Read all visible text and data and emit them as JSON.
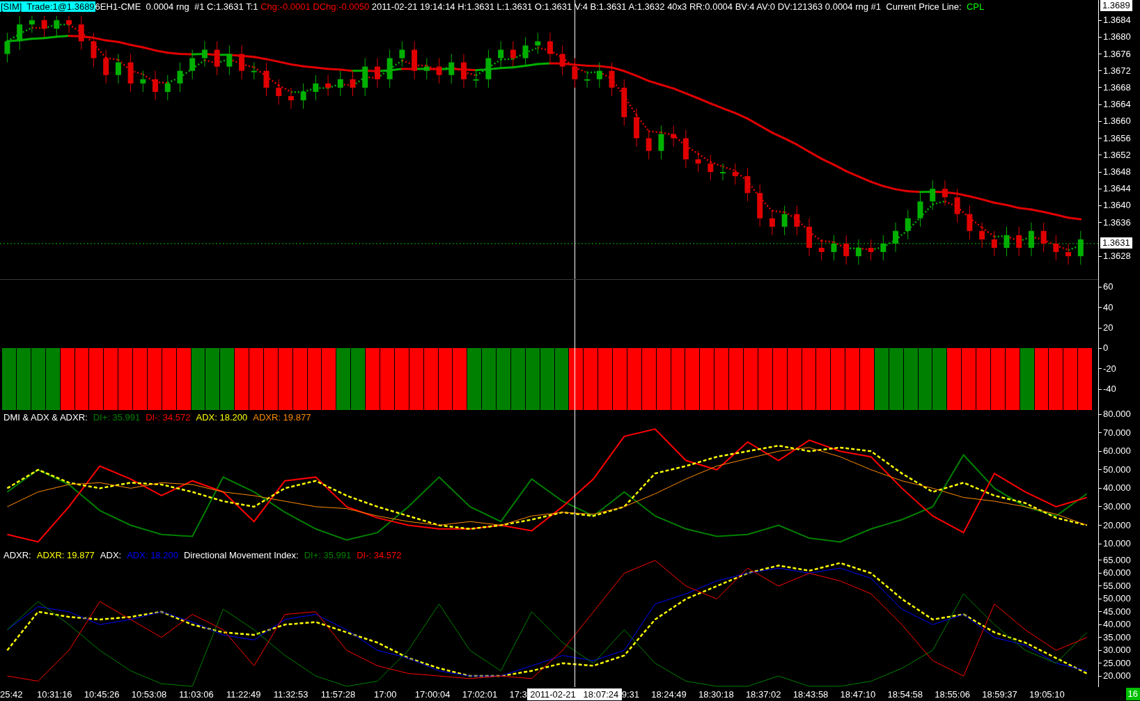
{
  "header": {
    "items": [
      {
        "kind": "badge",
        "text": "[SIM]  Trade:1@1.3689",
        "color": "#00ffff"
      },
      {
        "kind": "text",
        "text": "6EH1-CME  0.0004 rng  #1 C:1.3631 T:1 ",
        "color": "#ffffff"
      },
      {
        "kind": "text",
        "text": "Chg:-0.0001 DChg:-0.0050 ",
        "color": "#ff0000"
      },
      {
        "kind": "text",
        "text": "2011-02-21 19:14:14 H:1.3631 L:1.3631 O:1.3631 V:4 B:1.3631 A:1.3632 40x3 RR:0.0004 BV:4 AV:0 DV:121363 0.0004 rng #1  Current Price Line:  ",
        "color": "#ffffff"
      },
      {
        "kind": "text",
        "text": "CPL",
        "color": "#00ff00"
      }
    ],
    "last_price": "1.3689"
  },
  "price_pane": {
    "chart_data": {
      "type": "candlestick",
      "ylim": [
        1.36224,
        1.36855
      ],
      "yticks": [
        {
          "value": 1.3684,
          "label": "1.3684"
        },
        {
          "value": 1.368,
          "label": "1.3680"
        },
        {
          "value": 1.3676,
          "label": "1.3676"
        },
        {
          "value": 1.3672,
          "label": "1.3672"
        },
        {
          "value": 1.3668,
          "label": "1.3668"
        },
        {
          "value": 1.3664,
          "label": "1.3664"
        },
        {
          "value": 1.366,
          "label": "1.3660"
        },
        {
          "value": 1.3656,
          "label": "1.3656"
        },
        {
          "value": 1.3652,
          "label": "1.3652"
        },
        {
          "value": 1.3648,
          "label": "1.3648"
        },
        {
          "value": 1.3644,
          "label": "1.3644"
        },
        {
          "value": 1.364,
          "label": "1.3640"
        },
        {
          "value": 1.3636,
          "label": "1.3636"
        },
        {
          "value": 1.3628,
          "label": "1.3628"
        }
      ],
      "categories": [
        null,
        null,
        null,
        null,
        null,
        null,
        null,
        null,
        null,
        null,
        null,
        null,
        null,
        null,
        null,
        null,
        null,
        null,
        null,
        null,
        null,
        null,
        null,
        null,
        null,
        null,
        null,
        null,
        null,
        null,
        null,
        null,
        null,
        null,
        null,
        null,
        null,
        null,
        null,
        null,
        null,
        null,
        null,
        null,
        null,
        null,
        null,
        null,
        null,
        null,
        null,
        null,
        null,
        null,
        null,
        null,
        null,
        null,
        null,
        null,
        null,
        null,
        null,
        null,
        null,
        null,
        null,
        null,
        null,
        null,
        null,
        null,
        null,
        null,
        null,
        null,
        null,
        null,
        null,
        null,
        null,
        null,
        null,
        null,
        null,
        null,
        null,
        null
      ],
      "ohlc": [
        [
          1.3676,
          1.3681,
          1.3674,
          1.3679
        ],
        [
          1.3679,
          1.3685,
          1.3677,
          1.3683
        ],
        [
          1.3683,
          1.3685,
          1.3681,
          1.3684
        ],
        [
          1.3684,
          1.3685,
          1.368,
          1.3682
        ],
        [
          1.3682,
          1.3685,
          1.368,
          1.3684
        ],
        [
          1.3684,
          1.3685,
          1.3681,
          1.3683
        ],
        [
          1.3683,
          1.3685,
          1.3677,
          1.3679
        ],
        [
          1.3679,
          1.3681,
          1.3673,
          1.3675
        ],
        [
          1.3675,
          1.3677,
          1.3669,
          1.3671
        ],
        [
          1.3671,
          1.3676,
          1.3669,
          1.3674
        ],
        [
          1.3674,
          1.3676,
          1.3667,
          1.3669
        ],
        [
          1.3669,
          1.3672,
          1.3667,
          1.367
        ],
        [
          1.367,
          1.3672,
          1.3665,
          1.3667
        ],
        [
          1.3667,
          1.3671,
          1.3665,
          1.3669
        ],
        [
          1.3669,
          1.3674,
          1.3667,
          1.3672
        ],
        [
          1.3672,
          1.3677,
          1.367,
          1.3675
        ],
        [
          1.3675,
          1.3679,
          1.3673,
          1.3677
        ],
        [
          1.3677,
          1.3679,
          1.3671,
          1.3673
        ],
        [
          1.3673,
          1.3678,
          1.3671,
          1.3676
        ],
        [
          1.3676,
          1.3678,
          1.367,
          1.3672
        ],
        [
          1.3672,
          1.3674,
          1.367,
          1.3672
        ],
        [
          1.3672,
          1.3674,
          1.3666,
          1.3668
        ],
        [
          1.3668,
          1.367,
          1.3664,
          1.3666
        ],
        [
          1.3666,
          1.3668,
          1.3663,
          1.3665
        ],
        [
          1.3665,
          1.3669,
          1.3663,
          1.3667
        ],
        [
          1.3667,
          1.3671,
          1.3665,
          1.3669
        ],
        [
          1.3669,
          1.3671,
          1.3666,
          1.3668
        ],
        [
          1.3668,
          1.3672,
          1.3666,
          1.367
        ],
        [
          1.367,
          1.3672,
          1.3666,
          1.3668
        ],
        [
          1.3668,
          1.3675,
          1.3666,
          1.3673
        ],
        [
          1.3673,
          1.3675,
          1.3668,
          1.367
        ],
        [
          1.367,
          1.3677,
          1.3668,
          1.3675
        ],
        [
          1.3675,
          1.3679,
          1.3673,
          1.3677
        ],
        [
          1.3677,
          1.3679,
          1.367,
          1.3672
        ],
        [
          1.3672,
          1.3675,
          1.367,
          1.3673
        ],
        [
          1.3673,
          1.3675,
          1.3669,
          1.3671
        ],
        [
          1.3671,
          1.3676,
          1.3669,
          1.3674
        ],
        [
          1.3674,
          1.3676,
          1.3668,
          1.367
        ],
        [
          1.367,
          1.3672,
          1.3668,
          1.367
        ],
        [
          1.367,
          1.3677,
          1.3668,
          1.3675
        ],
        [
          1.3675,
          1.3679,
          1.3673,
          1.3677
        ],
        [
          1.3677,
          1.3679,
          1.3673,
          1.3675
        ],
        [
          1.3675,
          1.368,
          1.3673,
          1.3678
        ],
        [
          1.3678,
          1.3681,
          1.3676,
          1.3679
        ],
        [
          1.3679,
          1.3681,
          1.3674,
          1.3676
        ],
        [
          1.3676,
          1.3678,
          1.3671,
          1.3673
        ],
        [
          1.3673,
          1.3675,
          1.3668,
          1.367
        ],
        [
          1.367,
          1.3672,
          1.3668,
          1.367
        ],
        [
          1.367,
          1.3674,
          1.3668,
          1.3672
        ],
        [
          1.3672,
          1.3674,
          1.3666,
          1.3668
        ],
        [
          1.3668,
          1.367,
          1.3659,
          1.3661
        ],
        [
          1.3661,
          1.3663,
          1.3654,
          1.3656
        ],
        [
          1.3656,
          1.3658,
          1.3651,
          1.3653
        ],
        [
          1.3653,
          1.3659,
          1.3651,
          1.3657
        ],
        [
          1.3657,
          1.3659,
          1.3654,
          1.3656
        ],
        [
          1.3656,
          1.3658,
          1.3649,
          1.3651
        ],
        [
          1.3651,
          1.3653,
          1.3648,
          1.365
        ],
        [
          1.365,
          1.3652,
          1.3646,
          1.3648
        ],
        [
          1.3648,
          1.365,
          1.3646,
          1.3648
        ],
        [
          1.3648,
          1.365,
          1.3645,
          1.3647
        ],
        [
          1.3647,
          1.3649,
          1.3641,
          1.3643
        ],
        [
          1.3643,
          1.3645,
          1.3635,
          1.3637
        ],
        [
          1.3637,
          1.3639,
          1.3633,
          1.3635
        ],
        [
          1.3635,
          1.364,
          1.3633,
          1.3638
        ],
        [
          1.3638,
          1.364,
          1.3633,
          1.3635
        ],
        [
          1.3635,
          1.3637,
          1.3628,
          1.363
        ],
        [
          1.363,
          1.3632,
          1.3627,
          1.3629
        ],
        [
          1.3629,
          1.3633,
          1.3627,
          1.3631
        ],
        [
          1.3631,
          1.3633,
          1.3626,
          1.3628
        ],
        [
          1.3628,
          1.3632,
          1.3626,
          1.363
        ],
        [
          1.363,
          1.3632,
          1.3627,
          1.3629
        ],
        [
          1.3629,
          1.3633,
          1.3627,
          1.3631
        ],
        [
          1.3631,
          1.3636,
          1.3629,
          1.3634
        ],
        [
          1.3634,
          1.3639,
          1.3632,
          1.3637
        ],
        [
          1.3637,
          1.3643,
          1.3635,
          1.3641
        ],
        [
          1.3641,
          1.3646,
          1.3639,
          1.3644
        ],
        [
          1.3644,
          1.3646,
          1.364,
          1.3642
        ],
        [
          1.3642,
          1.3644,
          1.3636,
          1.3638
        ],
        [
          1.3638,
          1.364,
          1.3632,
          1.3634
        ],
        [
          1.3634,
          1.3636,
          1.363,
          1.3632
        ],
        [
          1.3632,
          1.3634,
          1.3628,
          1.363
        ],
        [
          1.363,
          1.3635,
          1.3628,
          1.3633
        ],
        [
          1.3633,
          1.3635,
          1.3628,
          1.363
        ],
        [
          1.363,
          1.3636,
          1.3628,
          1.3634
        ],
        [
          1.3634,
          1.3636,
          1.3629,
          1.3631
        ],
        [
          1.3631,
          1.3633,
          1.3627,
          1.3629
        ],
        [
          1.3629,
          1.3631,
          1.3626,
          1.3628
        ],
        [
          1.3628,
          1.3634,
          1.3626,
          1.3632
        ]
      ]
    },
    "current_price": "1.3631"
  },
  "oscillator_pane": {
    "chart_data": {
      "type": "bar",
      "stacked": true,
      "ylim": [
        -61,
        67
      ],
      "yticks": [
        {
          "value": 60,
          "label": "60"
        },
        {
          "value": 40,
          "label": "40"
        },
        {
          "value": 20,
          "label": "20"
        },
        {
          "value": 0,
          "label": "0"
        },
        {
          "value": -20,
          "label": "-20"
        },
        {
          "value": -40,
          "label": "-40"
        }
      ],
      "categories": [
        null,
        null,
        null,
        null,
        null,
        null,
        null,
        null,
        null,
        null,
        null,
        null,
        null,
        null,
        null,
        null,
        null,
        null,
        null,
        null,
        null,
        null,
        null,
        null,
        null,
        null,
        null,
        null,
        null,
        null,
        null,
        null,
        null,
        null,
        null,
        null,
        null,
        null,
        null,
        null,
        null,
        null,
        null,
        null,
        null,
        null,
        null,
        null,
        null,
        null,
        null,
        null,
        null,
        null,
        null,
        null,
        null,
        null,
        null,
        null,
        null,
        null,
        null,
        null,
        null,
        null,
        null,
        null,
        null,
        null,
        null,
        null,
        null,
        null,
        null
      ],
      "series": [
        {
          "color": "#008000",
          "values": [
            -60,
            -60,
            -60,
            -60,
            null,
            null,
            null,
            null,
            null,
            null,
            null,
            null,
            null,
            -60,
            -60,
            -60,
            null,
            null,
            null,
            null,
            null,
            null,
            null,
            -60,
            -60,
            null,
            null,
            null,
            null,
            null,
            null,
            null,
            -60,
            -60,
            -60,
            -60,
            -60,
            -60,
            -60,
            null,
            null,
            null,
            null,
            null,
            null,
            null,
            null,
            null,
            null,
            null,
            null,
            null,
            null,
            null,
            null,
            null,
            null,
            null,
            null,
            null,
            -60,
            -60,
            -60,
            -60,
            -60,
            null,
            null,
            null,
            null,
            null,
            -60,
            null,
            null,
            null,
            null
          ]
        },
        {
          "color": "#ff0000",
          "values": [
            null,
            null,
            null,
            null,
            -60,
            -60,
            -60,
            -60,
            -60,
            -60,
            -60,
            -60,
            -60,
            null,
            null,
            null,
            -60,
            -60,
            -60,
            -60,
            -60,
            -60,
            -60,
            null,
            null,
            -60,
            -60,
            -60,
            -60,
            -60,
            -60,
            -60,
            null,
            null,
            null,
            null,
            null,
            null,
            null,
            -60,
            -60,
            -60,
            -60,
            -60,
            -60,
            -60,
            -60,
            -60,
            -60,
            -60,
            -60,
            -60,
            -60,
            -60,
            -60,
            -60,
            -60,
            -60,
            -60,
            -60,
            null,
            null,
            null,
            null,
            null,
            -60,
            -60,
            -60,
            -60,
            -60,
            null,
            -60,
            -60,
            -60,
            -60
          ]
        }
      ]
    }
  },
  "dmi_pane": {
    "legend": [
      {
        "text": "DMI & ADX & ADXR:",
        "color": "#ffffff"
      },
      {
        "text": "DI+: 35.991",
        "color": "#008000"
      },
      {
        "text": "DI-: 34.572",
        "color": "#ff0000"
      },
      {
        "text": "ADX: 18.200",
        "color": "#ffff00"
      },
      {
        "text": "ADXR: 19.877",
        "color": "#ff8c00"
      }
    ],
    "chart_data": {
      "type": "line",
      "ylim": [
        7.4,
        81.9
      ],
      "yticks": [
        {
          "value": 80,
          "label": "80.000"
        },
        {
          "value": 70,
          "label": "70.000"
        },
        {
          "value": 60,
          "label": "60.000"
        },
        {
          "value": 50,
          "label": "50.000"
        },
        {
          "value": 40,
          "label": "40.000"
        },
        {
          "value": 30,
          "label": "30.000"
        },
        {
          "value": 20,
          "label": "20.000"
        },
        {
          "value": 10,
          "label": "10.000"
        }
      ],
      "series": [
        {
          "color": "#008000",
          "values": [
            38,
            50,
            42,
            28,
            20,
            15,
            14,
            46,
            38,
            27,
            18,
            12,
            16,
            30,
            46,
            30,
            22,
            45,
            33,
            25,
            38,
            25,
            18,
            14,
            15,
            20,
            13,
            11,
            18,
            23,
            30,
            58,
            40,
            30,
            25,
            37
          ]
        },
        {
          "color": "#ff0000",
          "values": [
            15,
            11,
            30,
            52,
            45,
            36,
            44,
            38,
            22,
            44,
            46,
            30,
            24,
            20,
            18,
            18,
            20,
            17,
            30,
            45,
            68,
            72,
            55,
            50,
            65,
            55,
            66,
            60,
            57,
            40,
            25,
            16,
            48,
            38,
            30,
            35
          ]
        },
        {
          "color": "#ffff00",
          "line_style": "dashed",
          "values": [
            40,
            50,
            43,
            40,
            43,
            42,
            38,
            33,
            30,
            40,
            44,
            36,
            30,
            25,
            20,
            18,
            20,
            23,
            27,
            25,
            30,
            48,
            52,
            57,
            60,
            63,
            60,
            62,
            60,
            48,
            38,
            43,
            36,
            32,
            24,
            20
          ]
        },
        {
          "color": "#ff8c00",
          "values": [
            30,
            38,
            42,
            43,
            40,
            43,
            42,
            38,
            36,
            33,
            30,
            29,
            25,
            22,
            20,
            22,
            20,
            25,
            27,
            26,
            30,
            37,
            45,
            52,
            56,
            60,
            62,
            57,
            50,
            44,
            40,
            35,
            33,
            30,
            26,
            20
          ]
        }
      ]
    }
  },
  "adxr_pane": {
    "legend": [
      {
        "text": "ADXR:",
        "color": "#ffffff"
      },
      {
        "text": "ADXR: 19.877",
        "color": "#ffff00"
      },
      {
        "text": "ADX:",
        "color": "#ffffff"
      },
      {
        "text": "ADX: 18.200",
        "color": "#0000ff"
      },
      {
        "text": "Directional Movement Index:",
        "color": "#ffffff"
      },
      {
        "text": "DI+: 35.991",
        "color": "#008000"
      },
      {
        "text": "DI-: 34.572",
        "color": "#ff0000"
      }
    ],
    "chart_data": {
      "type": "line",
      "ylim": [
        15.7,
        69.6
      ],
      "yticks": [
        {
          "value": 65,
          "label": "65.000"
        },
        {
          "value": 60,
          "label": "60.000"
        },
        {
          "value": 55,
          "label": "55.000"
        },
        {
          "value": 50,
          "label": "50.000"
        },
        {
          "value": 45,
          "label": "45.000"
        },
        {
          "value": 40,
          "label": "40.000"
        },
        {
          "value": 35,
          "label": "35.000"
        },
        {
          "value": 30,
          "label": "30.000"
        },
        {
          "value": 25,
          "label": "25.000"
        },
        {
          "value": 20,
          "label": "20.000"
        }
      ],
      "series": [
        {
          "color": "#ffff00",
          "line_style": "dashed",
          "values": [
            30,
            45,
            43,
            42,
            43,
            45,
            40,
            37,
            36,
            40,
            41,
            37,
            33,
            27,
            23,
            20,
            20,
            22,
            25,
            24,
            28,
            42,
            50,
            55,
            60,
            63,
            61,
            64,
            60,
            50,
            42,
            44,
            37,
            33,
            27,
            21
          ]
        },
        {
          "color": "#0000ff",
          "values": [
            38,
            47,
            45,
            40,
            42,
            45,
            41,
            36,
            34,
            42,
            44,
            38,
            30,
            27,
            22,
            20,
            20,
            24,
            28,
            26,
            30,
            48,
            52,
            57,
            60,
            62,
            60,
            62,
            58,
            46,
            40,
            44,
            35,
            32,
            25,
            22
          ]
        },
        {
          "color": "#008000",
          "values": [
            38,
            49,
            40,
            30,
            22,
            17,
            16,
            46,
            38,
            28,
            20,
            16,
            18,
            30,
            48,
            30,
            22,
            45,
            33,
            25,
            38,
            25,
            18,
            16,
            16,
            20,
            16,
            16,
            18,
            23,
            30,
            52,
            40,
            30,
            25,
            37
          ]
        },
        {
          "color": "#ff0000",
          "values": [
            20,
            18,
            30,
            49,
            42,
            35,
            44,
            38,
            24,
            44,
            45,
            30,
            24,
            21,
            20,
            19,
            20,
            19,
            30,
            45,
            60,
            65,
            55,
            50,
            62,
            55,
            60,
            57,
            52,
            40,
            26,
            20,
            48,
            38,
            30,
            35
          ]
        }
      ]
    }
  },
  "time_axis": {
    "labels": [
      {
        "kind": "tail",
        "text": "25:42"
      },
      {
        "kind": "tick",
        "text": "10:31:16"
      },
      {
        "kind": "tick",
        "text": "10:45:26"
      },
      {
        "kind": "tick",
        "text": "10:53:08"
      },
      {
        "kind": "tick",
        "text": "11:03:06"
      },
      {
        "kind": "tick",
        "text": "11:22:49"
      },
      {
        "kind": "tick",
        "text": "11:32:53"
      },
      {
        "kind": "tick",
        "text": "11:57:28"
      },
      {
        "kind": "tick",
        "text": "17:00"
      },
      {
        "kind": "tick",
        "text": "17:00:04"
      },
      {
        "kind": "tick",
        "text": "17:02:01"
      },
      {
        "kind": "head",
        "text": "17:3"
      },
      {
        "kind": "cursor",
        "text": "2011-02-21   18:07:24"
      },
      {
        "kind": "tail",
        "text": "9:31"
      },
      {
        "kind": "tick",
        "text": "18:24:49"
      },
      {
        "kind": "tick",
        "text": "18:30:18"
      },
      {
        "kind": "tick",
        "text": "18:37:02"
      },
      {
        "kind": "tick",
        "text": "18:43:58"
      },
      {
        "kind": "tick",
        "text": "18:47:10"
      },
      {
        "kind": "tick",
        "text": "18:54:58"
      },
      {
        "kind": "tick",
        "text": "18:55:06"
      },
      {
        "kind": "tick",
        "text": "18:59:37"
      },
      {
        "kind": "tick",
        "text": "19:05:10"
      }
    ],
    "corner": "16"
  }
}
